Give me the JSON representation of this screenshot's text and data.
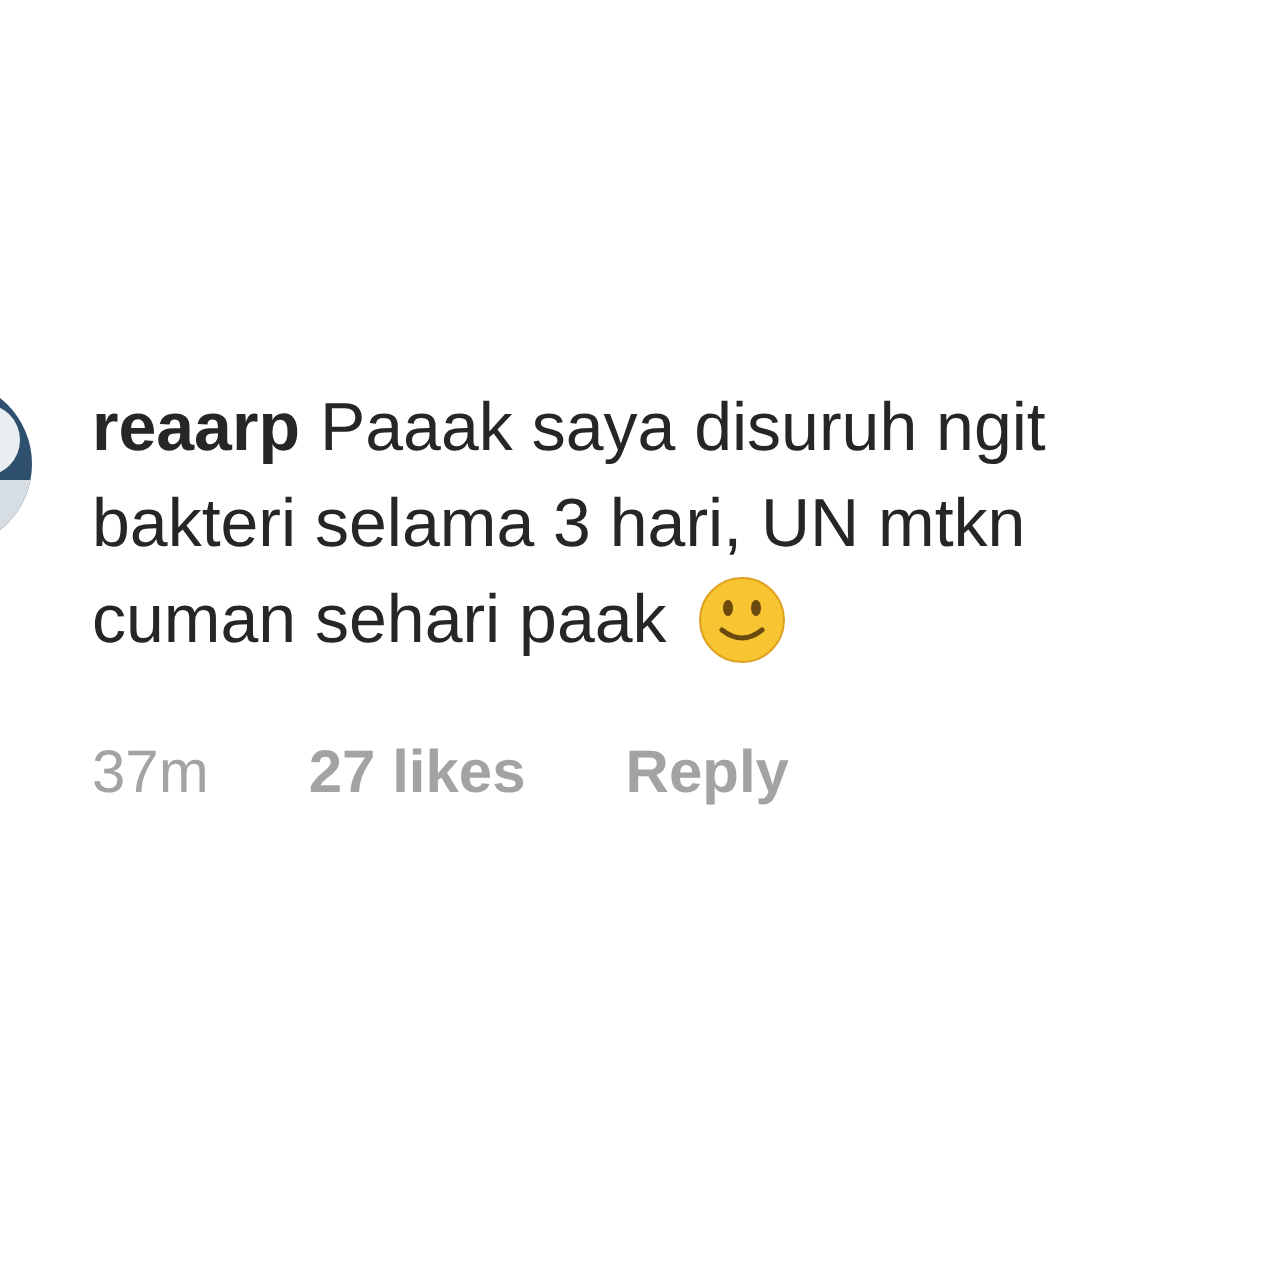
{
  "comment": {
    "username": "reaarp",
    "lines": [
      "Paaak saya disuruh ngit",
      "bakteri selama 3 hari, UN mtkn",
      "cuman sehari paak"
    ],
    "time": "37m",
    "likes": "27 likes",
    "reply": "Reply"
  }
}
